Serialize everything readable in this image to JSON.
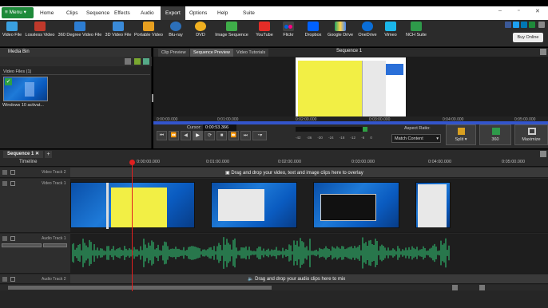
{
  "titlebar": {
    "menu_label": "Menu",
    "tabs": [
      "Home",
      "Clips",
      "Sequence",
      "Effects",
      "Audio",
      "Export",
      "Options",
      "Help",
      "Suite"
    ],
    "active_tab": "Export",
    "window_controls": [
      "–",
      "▫",
      "✕"
    ]
  },
  "ribbon": {
    "buttons": [
      "Video File",
      "Lossless Video",
      "360 Degree Video File",
      "3D Video File",
      "Portable Video",
      "Blu-ray",
      "DVD",
      "Image Sequence",
      "YouTube",
      "Flickr",
      "Dropbox",
      "Google Drive",
      "OneDrive",
      "Vimeo",
      "NCH Suite"
    ],
    "buy_online": "Buy Online",
    "icon_colors": [
      "#3aa0e0",
      "#c0392b",
      "#2d7dd2",
      "#3a8ad8",
      "#e8a020",
      "#2c6fb8",
      "#f0b020",
      "#3fae49",
      "#e52d27",
      "#ff0084",
      "#0061fe",
      "#1fa463",
      "#0a6ed8",
      "#1ab7ea",
      "#2e9a4a"
    ]
  },
  "mediabin": {
    "title": "Media Bin",
    "section": "Video Files (1)",
    "file_name": "Windows 10 activat..."
  },
  "preview": {
    "tabs": [
      "Clip Preview",
      "Sequence Preview",
      "Video Tutorials"
    ],
    "active_tab": "Sequence Preview",
    "sequence_title": "Sequence 1",
    "ruler_ticks": [
      "0:00:00.000",
      "0:01:00.000",
      "0:02:00.000",
      "0:03:00.000",
      "0:04:00.000",
      "0:05:00.000"
    ],
    "cursor_label": "Cursor:",
    "cursor_value": "0:00:53.366",
    "db_scale": [
      "-42",
      "-36",
      "-30",
      "-24",
      "-18",
      "-12",
      "-6",
      "0"
    ],
    "aspect_label": "Aspect Ratio:",
    "aspect_value": "Match Content",
    "split_label": "Split",
    "view360_label": "360",
    "maximize_label": "Maximize"
  },
  "timeline": {
    "sequence_tab": "Sequence 1",
    "label": "Timeline",
    "ticks": [
      "0:00:00.000",
      "0:01:00.000",
      "0:02:00.000",
      "0:03:00.000",
      "0:04:00.000",
      "0:05:00.000",
      "0:06:00.000"
    ],
    "video_track_2": "Video Track 2",
    "video_track_1": "Video Track 1",
    "audio_track_1": "Audio Track 1",
    "audio_track_2": "Audio Track 2",
    "overlay_hint": "Drag and drop your video, text and image clips here to overlay",
    "mix_hint": "Drag and drop your audio clips here to mix"
  }
}
